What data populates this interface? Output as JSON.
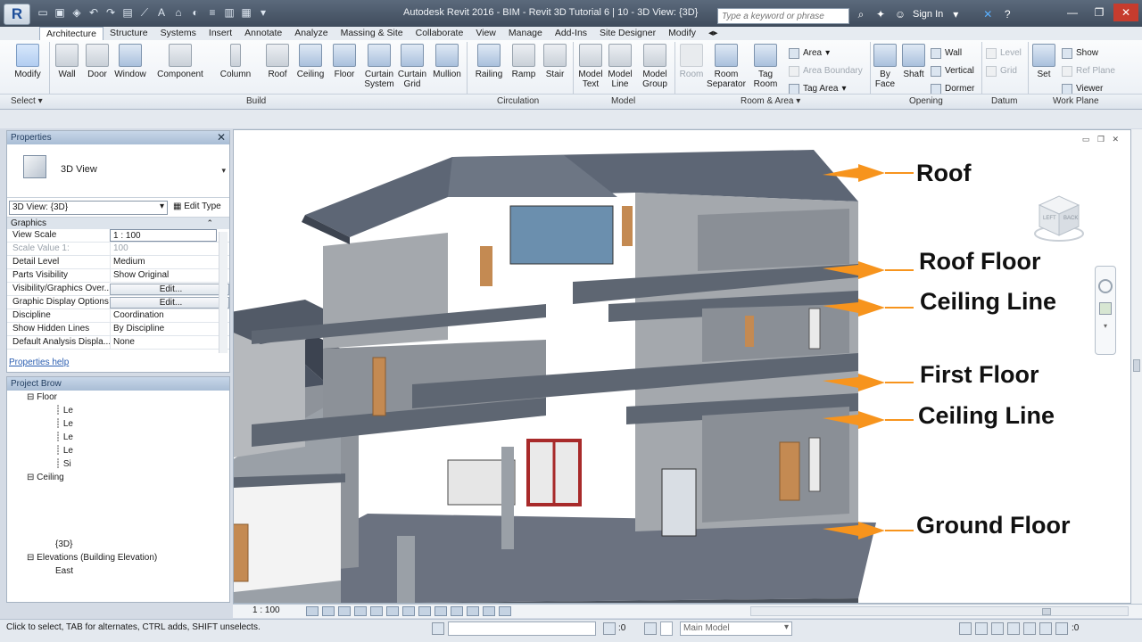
{
  "titlebar": {
    "app_logo": "R",
    "window_title": "Autodesk Revit 2016 -    BIM - Revit 3D Tutorial 6 | 10 - 3D View: {3D}",
    "search_placeholder": "Type a keyword or phrase",
    "sign_in": "Sign In"
  },
  "tabs": [
    "Architecture",
    "Structure",
    "Systems",
    "Insert",
    "Annotate",
    "Analyze",
    "Massing & Site",
    "Collaborate",
    "View",
    "Manage",
    "Add-Ins",
    "Site Designer",
    "Modify"
  ],
  "ribbon": {
    "modify": "Modify",
    "select": "Select",
    "build": [
      "Wall",
      "Door",
      "Window",
      "Component",
      "Column",
      "Roof",
      "Ceiling",
      "Floor",
      "Curtain System",
      "Curtain Grid",
      "Mullion"
    ],
    "circulation": [
      "Railing",
      "Ramp",
      "Stair"
    ],
    "model": [
      "Model Text",
      "Model Line",
      "Model Group"
    ],
    "room_area": {
      "room": "Room",
      "room_separator": "Room Separator",
      "tag_room": "Tag Room",
      "area": "Area",
      "area_boundary": "Area Boundary",
      "tag_area": "Tag Area"
    },
    "opening": {
      "by_face": "By Face",
      "shaft": "Shaft",
      "wall": "Wall",
      "vertical": "Vertical",
      "dormer": "Dormer"
    },
    "datum": {
      "level": "Level",
      "grid": "Grid"
    },
    "work_plane": {
      "set": "Set",
      "show": "Show",
      "ref_plane": "Ref Plane",
      "viewer": "Viewer"
    },
    "panel_titles": {
      "select": "Select",
      "build": "Build",
      "circulation": "Circulation",
      "model": "Model",
      "room_area": "Room & Area",
      "opening": "Opening",
      "datum": "Datum",
      "work_plane": "Work Plane"
    }
  },
  "properties": {
    "header": "Properties",
    "type_name": "3D View",
    "view_selector": "3D View: {3D}",
    "edit_type": "Edit Type",
    "group": "Graphics",
    "rows": [
      {
        "key": "View Scale",
        "value": "1 : 100"
      },
      {
        "key": "Scale Value    1:",
        "value": "100"
      },
      {
        "key": "Detail Level",
        "value": "Medium"
      },
      {
        "key": "Parts Visibility",
        "value": "Show Original"
      },
      {
        "key": "Visibility/Graphics Over...",
        "value": "Edit..."
      },
      {
        "key": "Graphic Display Options",
        "value": "Edit..."
      },
      {
        "key": "Discipline",
        "value": "Coordination"
      },
      {
        "key": "Show Hidden Lines",
        "value": "By Discipline"
      },
      {
        "key": "Default Analysis Displa...",
        "value": "None"
      }
    ],
    "help_link": "Properties help"
  },
  "browser": {
    "header": "Project Brow",
    "items": [
      {
        "label": "Floor",
        "indent": 1
      },
      {
        "label": "Le",
        "indent": 3
      },
      {
        "label": "Le",
        "indent": 3
      },
      {
        "label": "Le",
        "indent": 3
      },
      {
        "label": "Le",
        "indent": 3
      },
      {
        "label": "Si",
        "indent": 3
      },
      {
        "label": "Ceiling",
        "indent": 1
      },
      {
        "label": "{3D}",
        "indent": 3
      },
      {
        "label": "Elevations (Building Elevation)",
        "indent": 1
      },
      {
        "label": "East",
        "indent": 3
      }
    ]
  },
  "viewport": {
    "labels": [
      "Roof",
      "Roof Floor",
      "Ceiling Line",
      "First Floor",
      "Ceiling Line",
      "Ground Floor"
    ],
    "viewcube_faces": [
      "LEFT",
      "BACK"
    ]
  },
  "view_control": {
    "scale": "1 : 100"
  },
  "status": {
    "message": "Click to select, TAB for alternates, CTRL adds, SHIFT unselects.",
    "count": ":0",
    "model": "Main Model",
    "filter_count": ":0"
  },
  "colors": {
    "roof": "#5d6675",
    "wall": "#9fa3a8",
    "floor_slab": "#6b7280",
    "arrow": "#f7941d",
    "door": "#c48a52",
    "glass": "#6b8fae",
    "frame_red": "#a82a2a"
  }
}
